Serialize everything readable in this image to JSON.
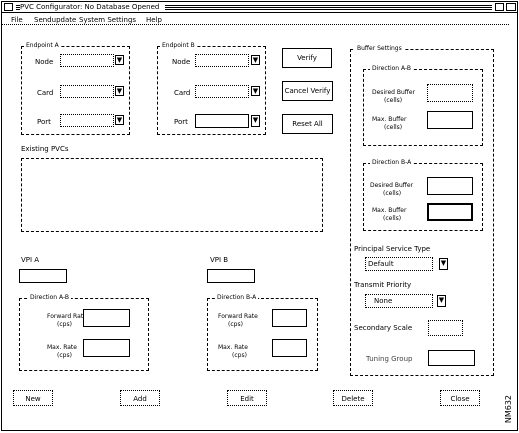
{
  "window": {
    "title": "PVC Configurator: No Database Opened"
  },
  "menu": [
    "File",
    "Sendupdate",
    "System Settings",
    "Help"
  ],
  "endpoint_a": {
    "title": "Endpoint A",
    "fields": [
      {
        "label": "Node",
        "value": "",
        "icon": "dropdown-arrow-icon"
      },
      {
        "label": "Card",
        "value": "",
        "icon": "dropdown-arrow-icon"
      },
      {
        "label": "Port",
        "value": "",
        "icon": "dropdown-arrow-icon"
      }
    ]
  },
  "endpoint_b": {
    "title": "Endpoint B",
    "fields": [
      {
        "label": "Node",
        "value": "",
        "icon": "dropdown-arrow-icon"
      },
      {
        "label": "Card",
        "value": "",
        "icon": "dropdown-arrow-icon"
      },
      {
        "label": "Port",
        "value": "",
        "icon": "dropdown-arrow-icon"
      }
    ]
  },
  "actions": {
    "verify": "Verify",
    "cancel_verify": "Cancel Verify",
    "reset_all": "Reset All"
  },
  "existing_pvcs": {
    "label": "Existing PVCs"
  },
  "vpi_a": {
    "label": "VPI A",
    "value": ""
  },
  "vpi_b": {
    "label": "VPI B",
    "value": ""
  },
  "dir_a_b": {
    "title": "Direction A-B",
    "fields": [
      {
        "label_1": "Forward Rate",
        "label_2": "(cps)",
        "value": ""
      },
      {
        "label_1": "Max. Rate",
        "label_2": "(cps)",
        "value": ""
      }
    ]
  },
  "dir_b_a": {
    "title": "Direction B-A",
    "fields": [
      {
        "label_1": "Forward Rate",
        "label_2": "(cps)",
        "value": ""
      },
      {
        "label_1": "Max. Rate",
        "label_2": "(cps)",
        "value": ""
      }
    ]
  },
  "buffer_settings": {
    "title": "Buffer Settings",
    "dir_ab": {
      "title": "Direction A-B",
      "fields": [
        {
          "label_1": "Desired Buffer",
          "label_2": "(cells)",
          "value": ""
        },
        {
          "label_1": "Max. Buffer",
          "label_2": "(cells)",
          "value": ""
        }
      ]
    },
    "dir_ba": {
      "title": "Direction B-A",
      "fields": [
        {
          "label_1": "Desired Buffer",
          "label_2": "(cells)",
          "value": ""
        },
        {
          "label_1": "Max. Buffer",
          "label_2": "(cells)",
          "value": ""
        }
      ]
    }
  },
  "principal_service_type": {
    "label": "Principal Service Type",
    "value": "Default"
  },
  "transmit_priority": {
    "label": "Transmit Priority",
    "value": "None"
  },
  "secondary_scale": {
    "label": "Secondary Scale",
    "value": ""
  },
  "tuning_group": {
    "label": "Tuning Group",
    "value": ""
  },
  "bottom_buttons": [
    "New",
    "Add",
    "Edit",
    "Delete",
    "Close"
  ],
  "figure_label": "NM632"
}
